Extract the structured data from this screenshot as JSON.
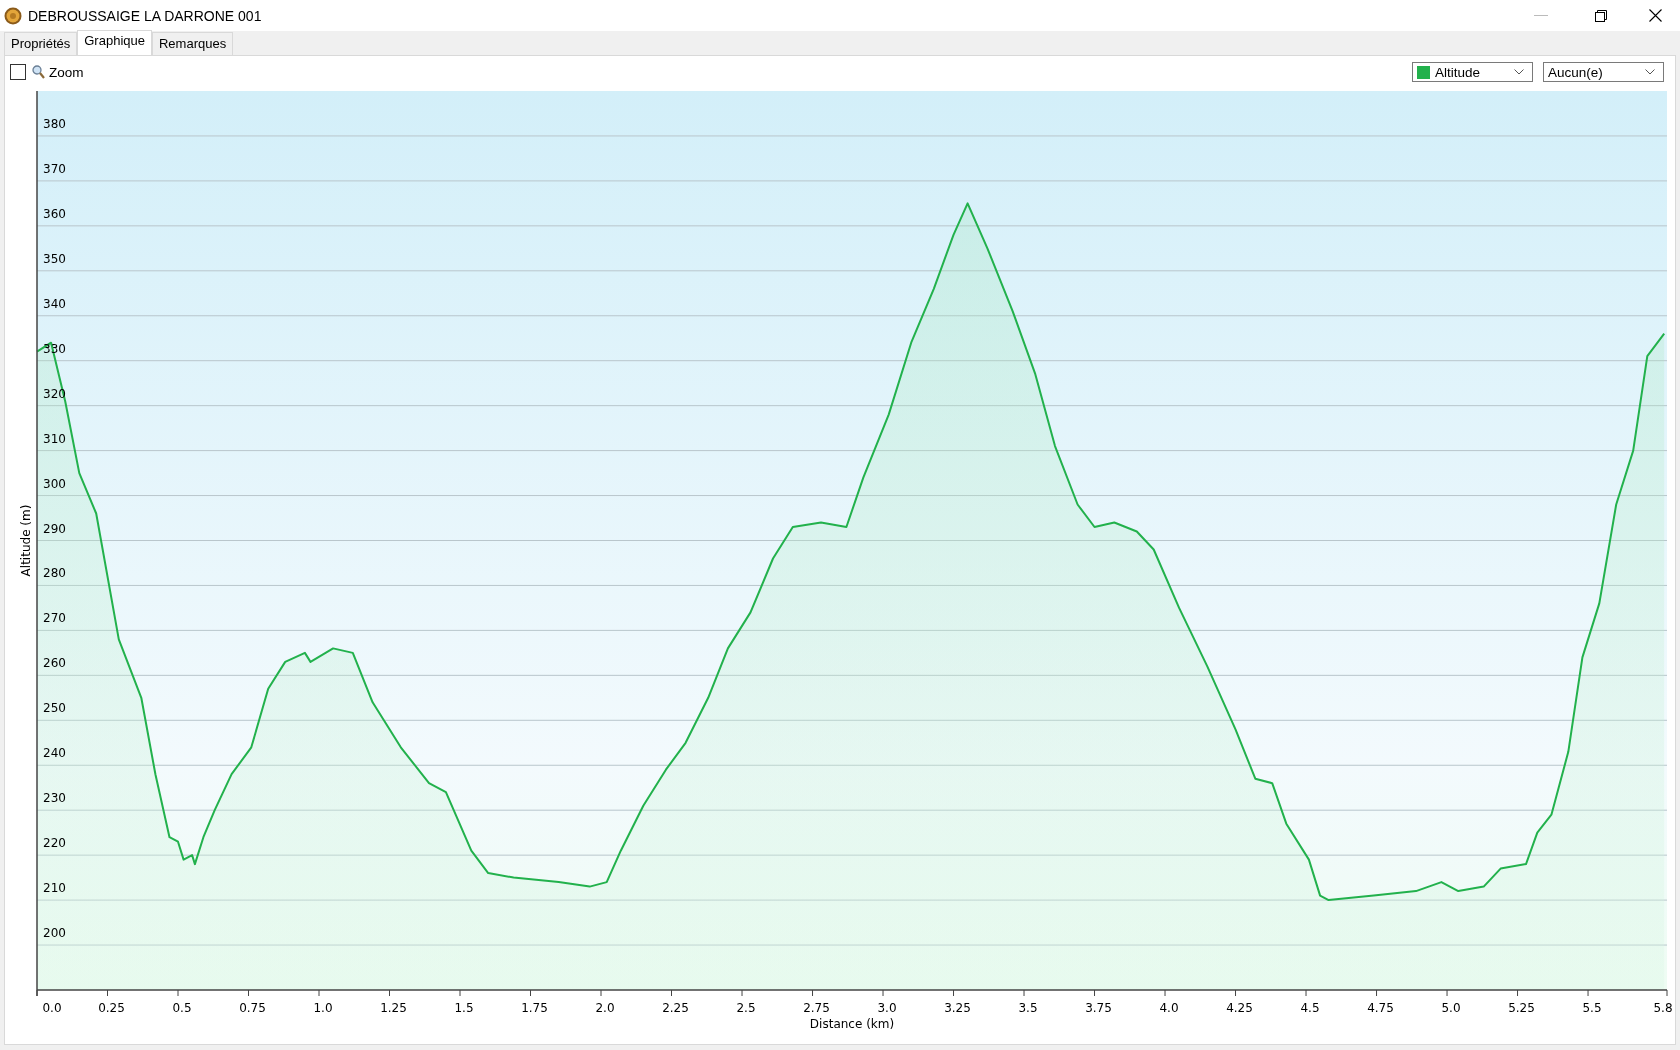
{
  "window": {
    "title": "DEBROUSSAIGE LA DARRONE 001"
  },
  "tabs": [
    {
      "label": "Propriétés",
      "selected": false
    },
    {
      "label": "Graphique",
      "selected": true
    },
    {
      "label": "Remarques",
      "selected": false
    }
  ],
  "toolbar": {
    "zoom": {
      "label": "Zoom",
      "checked": false
    },
    "second_dropdown": {
      "value": "Aucun(e)"
    }
  },
  "chart_data": {
    "type": "area",
    "xlabel": "Distance    (km)",
    "ylabel": "Altitude (m)",
    "x": [
      0,
      0.05,
      0.1,
      0.15,
      0.21,
      0.29,
      0.37,
      0.42,
      0.47,
      0.5,
      0.52,
      0.55,
      0.56,
      0.59,
      0.63,
      0.69,
      0.76,
      0.82,
      0.88,
      0.95,
      0.97,
      1.05,
      1.12,
      1.19,
      1.29,
      1.39,
      1.45,
      1.54,
      1.6,
      1.69,
      1.85,
      1.96,
      2.02,
      2.07,
      2.15,
      2.23,
      2.3,
      2.38,
      2.45,
      2.53,
      2.61,
      2.68,
      2.78,
      2.87,
      2.93,
      3.02,
      3.1,
      3.18,
      3.25,
      3.3,
      3.37,
      3.46,
      3.54,
      3.61,
      3.69,
      3.75,
      3.82,
      3.9,
      3.96,
      4.05,
      4.15,
      4.25,
      4.32,
      4.38,
      4.43,
      4.51,
      4.55,
      4.58,
      4.74,
      4.89,
      4.98,
      5.04,
      5.13,
      5.19,
      5.28,
      5.32,
      5.37,
      5.43,
      5.48,
      5.54,
      5.6,
      5.66,
      5.71,
      5.77
    ],
    "series": [
      {
        "name": "Altitude",
        "color": "#22b14c",
        "values": [
          332,
          334,
          321,
          305,
          296,
          268,
          255,
          238,
          224,
          223,
          219,
          220,
          218,
          224,
          230,
          238,
          244,
          257,
          263,
          265,
          263,
          266,
          265,
          254,
          244,
          236,
          234,
          221,
          216,
          215,
          214,
          213,
          214,
          221,
          231,
          239,
          245,
          255,
          266,
          274,
          286,
          293,
          294,
          293,
          304,
          318,
          334,
          346,
          358,
          365,
          355,
          341,
          327,
          311,
          298,
          293,
          294,
          292,
          288,
          275,
          262,
          248,
          237,
          236,
          227,
          219,
          211,
          210,
          211,
          212,
          214,
          212,
          213,
          217,
          218,
          225,
          229,
          243,
          264,
          276,
          298,
          310,
          331,
          336
        ]
      }
    ],
    "xlim": [
      0,
      5.78
    ],
    "ylim": [
      190,
      390
    ],
    "xticks": [
      {
        "value": 0,
        "label": "0.0"
      },
      0.25,
      0.5,
      0.75,
      {
        "value": 1,
        "label": "1.0"
      },
      1.25,
      1.5,
      1.75,
      {
        "value": 2,
        "label": "2.0"
      },
      2.25,
      2.5,
      2.75,
      {
        "value": 3,
        "label": "3.0"
      },
      3.25,
      3.5,
      3.75,
      {
        "value": 4,
        "label": "4.0"
      },
      4.25,
      4.5,
      4.75,
      {
        "value": 5,
        "label": "5.0"
      },
      5.25,
      5.5,
      {
        "value": 5.78,
        "label": "5.8"
      }
    ],
    "grid": true,
    "yticks": [
      200,
      210,
      220,
      230,
      240,
      250,
      260,
      270,
      280,
      290,
      300,
      310,
      320,
      330,
      340,
      350,
      360,
      370,
      380
    ]
  }
}
